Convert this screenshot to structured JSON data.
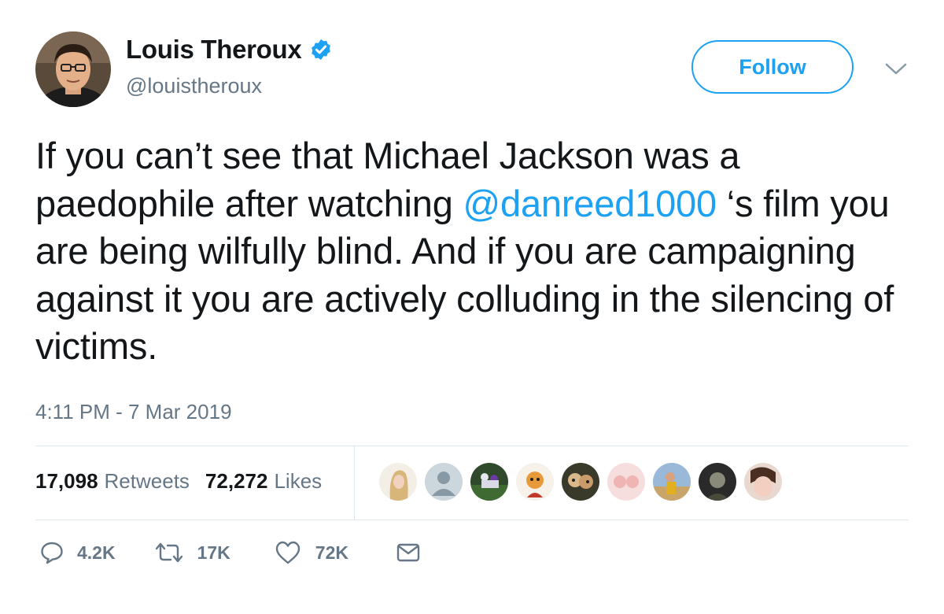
{
  "tweet": {
    "author": {
      "name": "Louis Theroux",
      "handle": "@louistheroux",
      "avatar_icon": "user-avatar-photo",
      "verified": true
    },
    "follow_label": "Follow",
    "text": {
      "part1": "If you can’t see that Michael Jackson was a paedophile after watching ",
      "mention": "@danreed1000",
      "part2": " ‘s film you are being wilfully blind. And if you are campaigning against it you are actively colluding in the silencing of victims."
    },
    "timestamp": "4:11 PM - 7 Mar 2019",
    "stats": {
      "retweets_count": "17,098",
      "retweets_label": "Retweets",
      "likes_count": "72,272",
      "likes_label": "Likes"
    },
    "actions": {
      "reply_count": "4.2K",
      "retweet_count": "17K",
      "like_count": "72K"
    }
  },
  "colors": {
    "accent": "#1da1f2",
    "secondary_text": "#657786",
    "divider": "#e1e8ed"
  }
}
